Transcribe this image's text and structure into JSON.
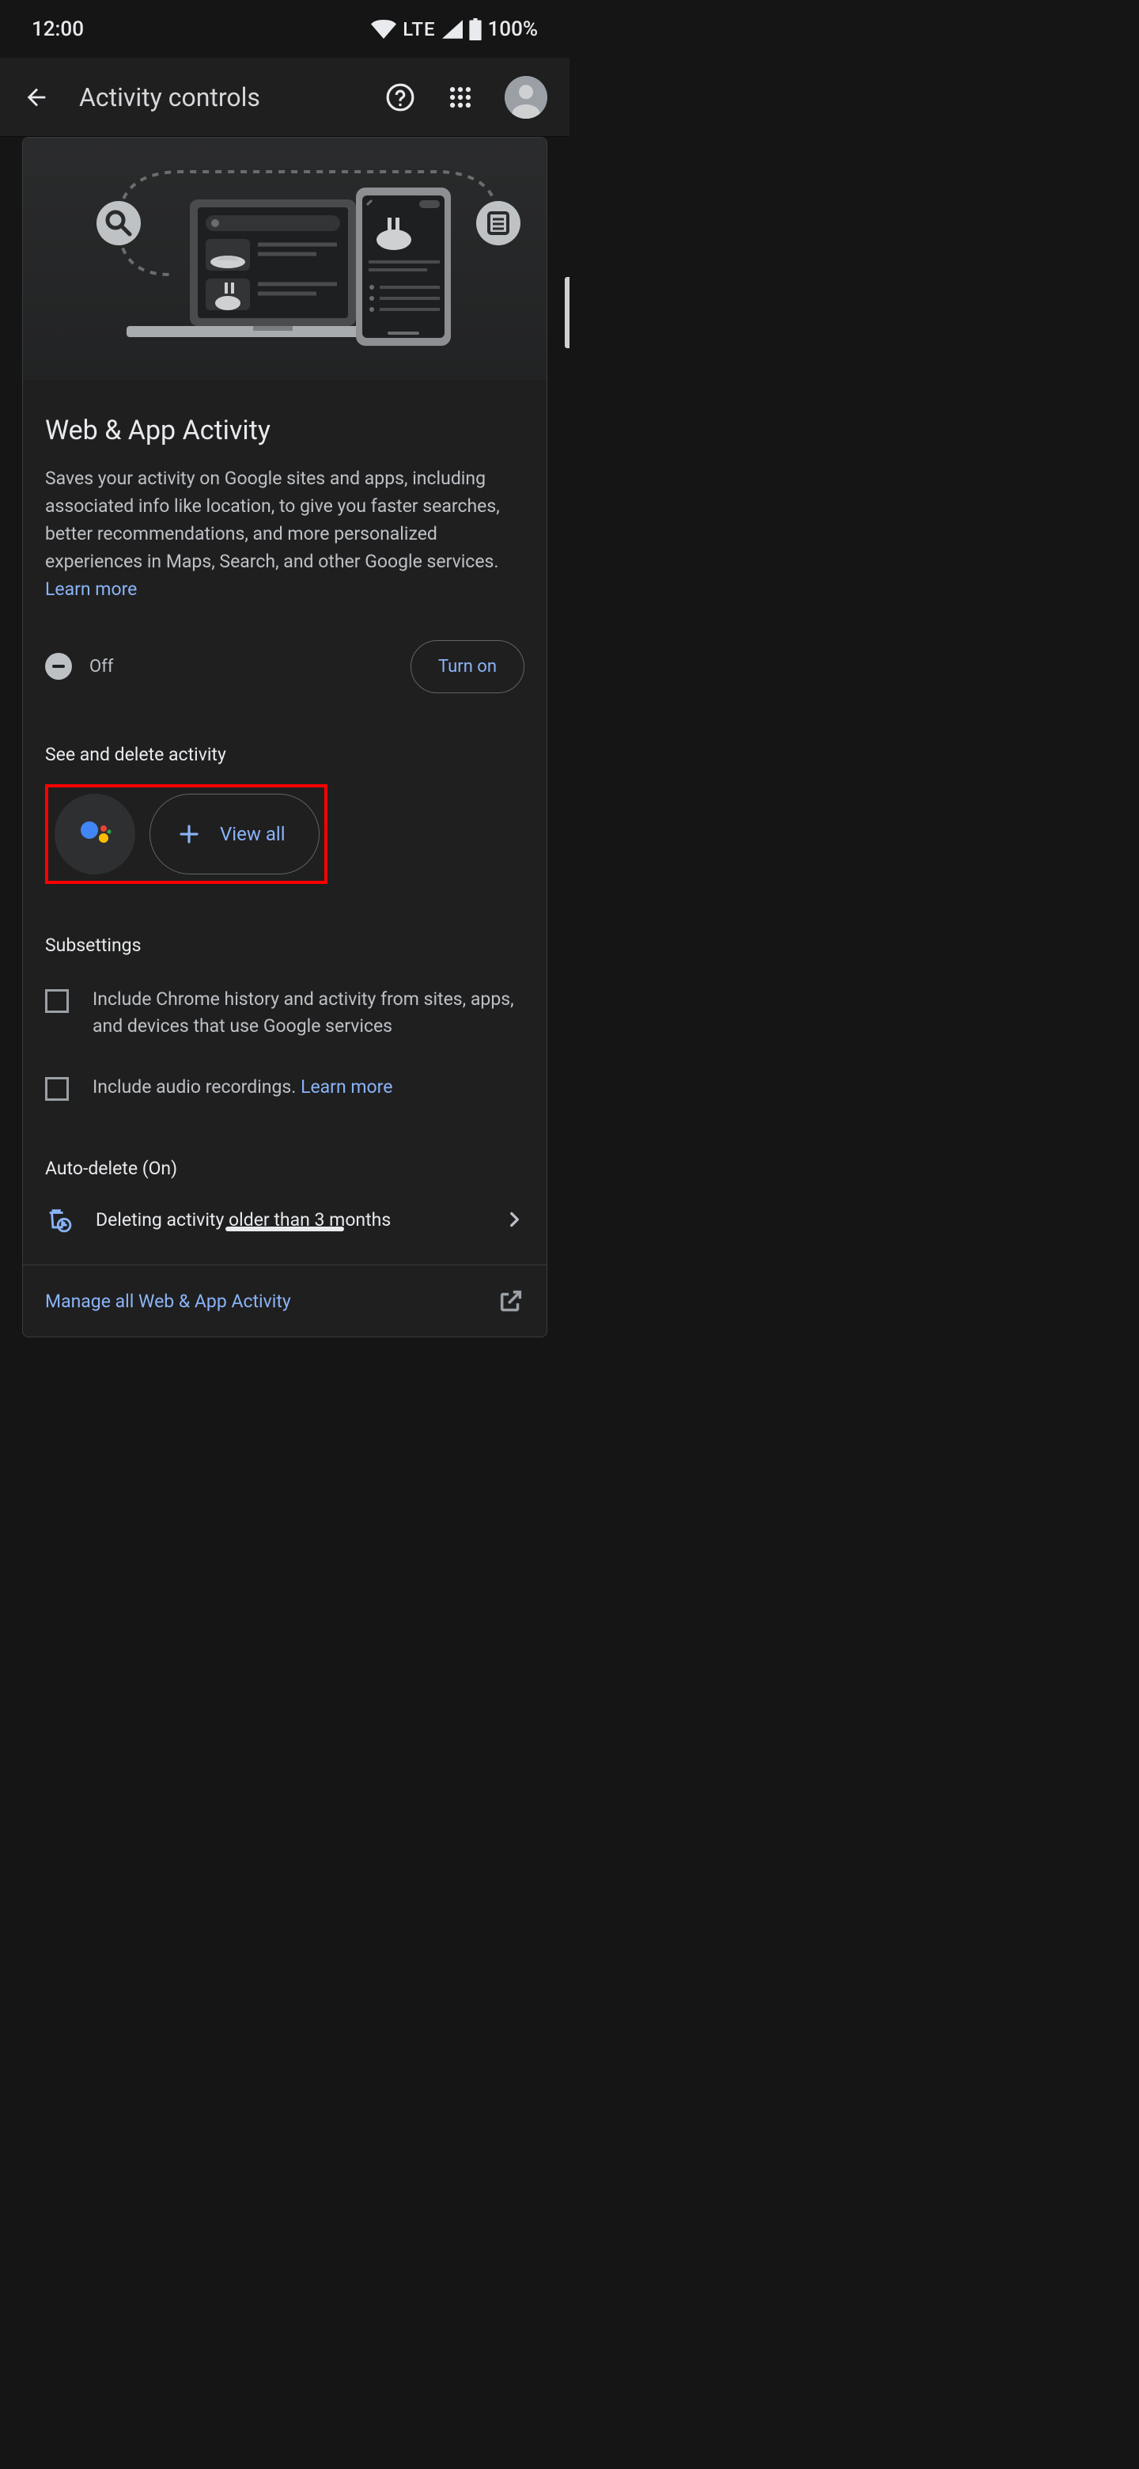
{
  "status": {
    "time": "12:00",
    "lte": "LTE",
    "battery": "100%"
  },
  "appbar": {
    "title": "Activity controls"
  },
  "card": {
    "title": "Web & App Activity",
    "desc": "Saves your activity on Google sites and apps, including associated info like location, to give you faster searches, better recommendations, and more personalized experiences in Maps, Search, and other Google services. ",
    "learn_more": "Learn more",
    "off_label": "Off",
    "turn_on": "Turn on",
    "see_delete_head": "See and delete activity",
    "view_all": "View all",
    "subsettings_head": "Subsettings",
    "sub1": "Include Chrome history and activity from sites, apps, and devices that use Google services",
    "sub2_a": "Include audio recordings. ",
    "sub2_link": "Learn more",
    "autodel_head": "Auto-delete (On)",
    "autodel_text": "Deleting activity older than 3 months",
    "manage": "Manage all Web & App Activity"
  }
}
